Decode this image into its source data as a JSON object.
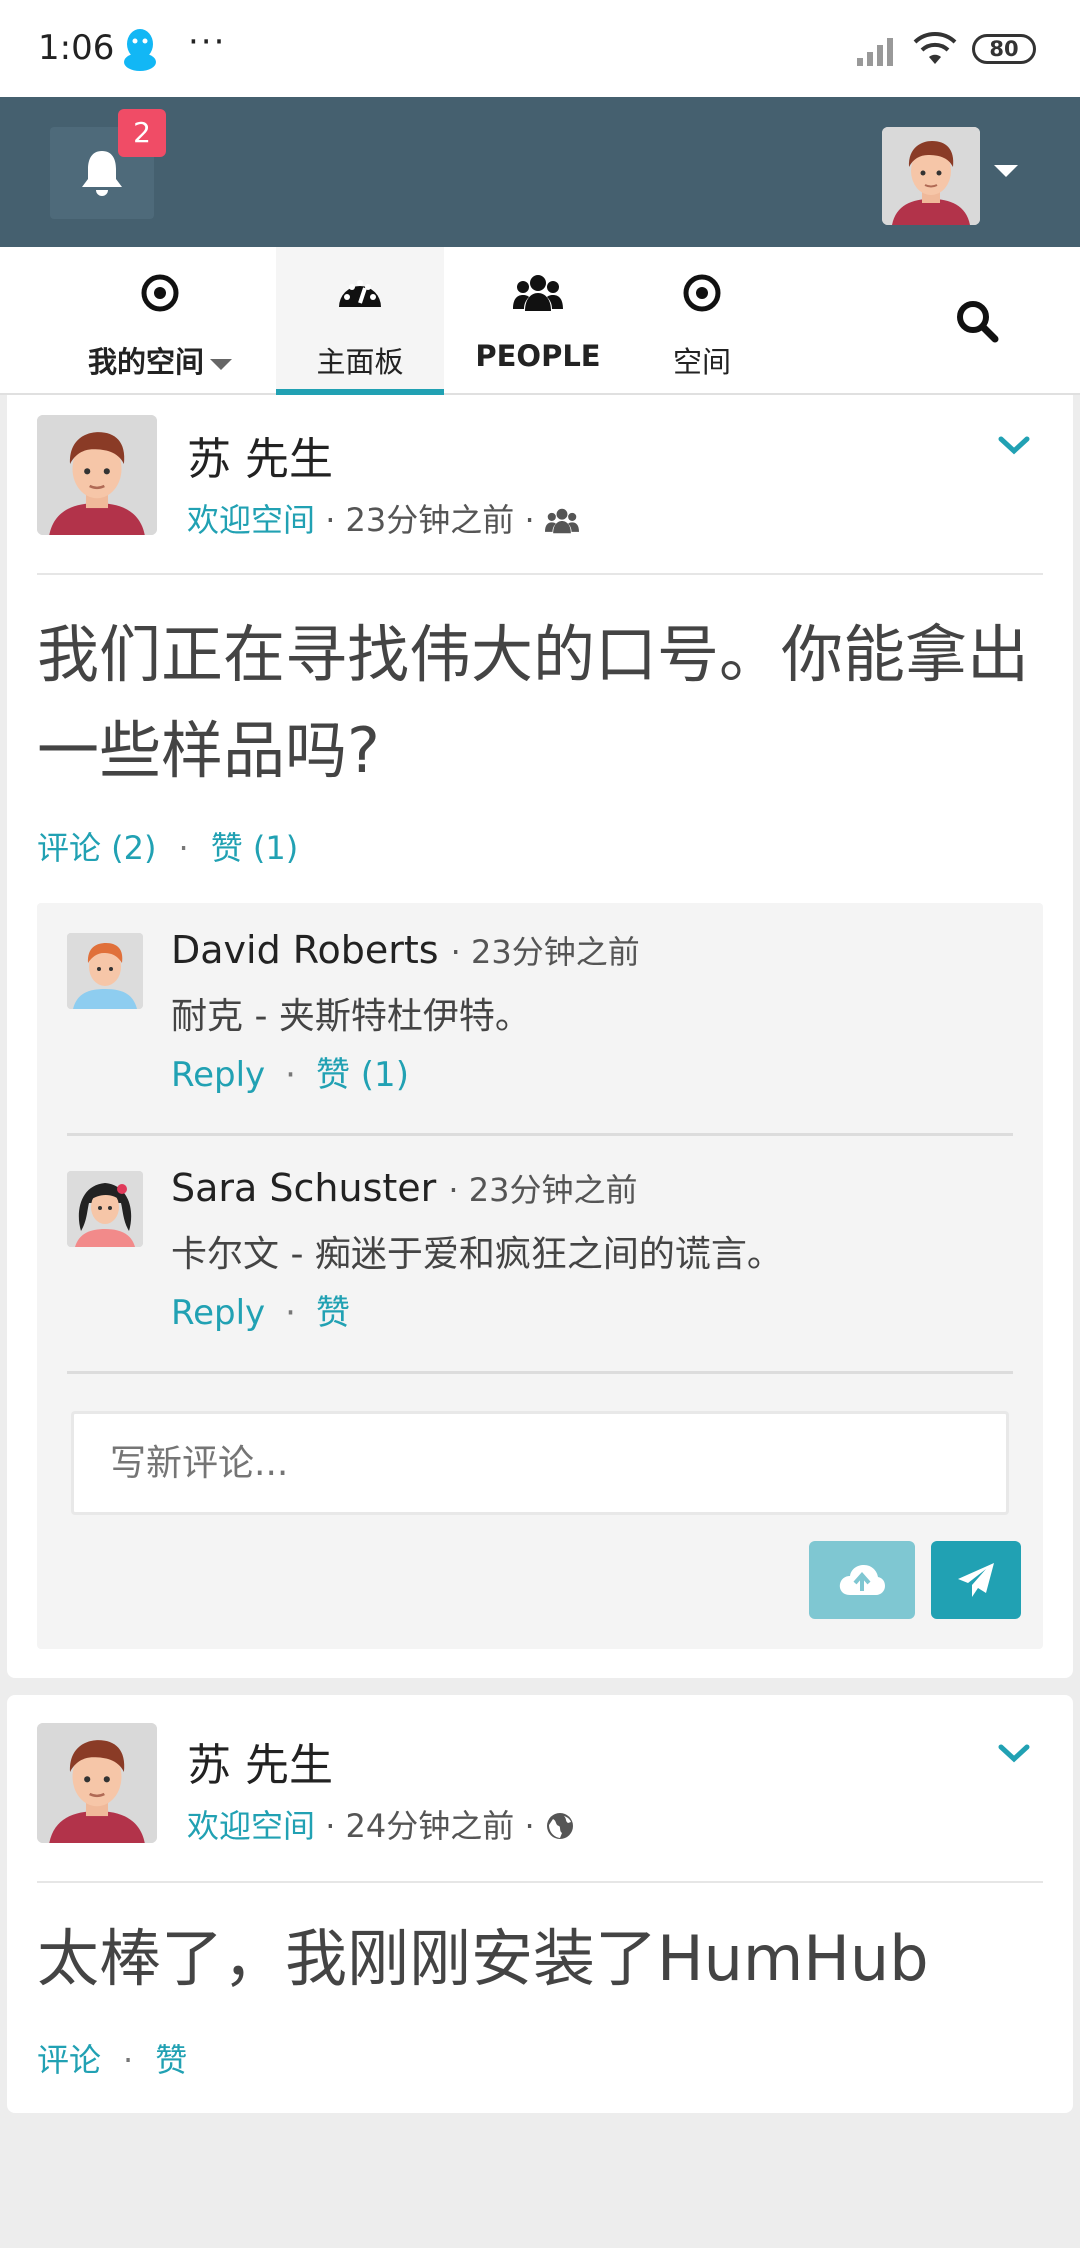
{
  "status_bar": {
    "time": "1:06",
    "dots": "···",
    "battery": "80"
  },
  "header": {
    "notifications_count": "2"
  },
  "nav": {
    "items": [
      {
        "label": "我的空间",
        "icon": "target-icon"
      },
      {
        "label": "主面板",
        "icon": "dashboard-icon"
      },
      {
        "label": "PEOPLE",
        "icon": "users-icon"
      },
      {
        "label": "空间",
        "icon": "target-icon"
      }
    ],
    "active": "主面板"
  },
  "posts": [
    {
      "author": "苏 先生",
      "space": "欢迎空间",
      "time": "23分钟之前",
      "visibility_icon": "users-icon",
      "text": "我们正在寻找伟大的口号。你能拿出一些样品吗?",
      "comment_link": "评论 (2)",
      "like_link": "赞 (1)",
      "comments": [
        {
          "author": "David Roberts",
          "time": "· 23分钟之前",
          "text": "耐克 - 夹斯特杜伊特。",
          "reply": "Reply",
          "like": "赞 (1)"
        },
        {
          "author": "Sara Schuster",
          "time": "· 23分钟之前",
          "text": "卡尔文 - 痴迷于爱和疯狂之间的谎言。",
          "reply": "Reply",
          "like": "赞"
        }
      ],
      "comment_placeholder": "写新评论..."
    },
    {
      "author": "苏 先生",
      "space": "欢迎空间",
      "time": "24分钟之前",
      "visibility_icon": "globe-icon",
      "text": "太棒了，我刚刚安装了HumHub",
      "comment_link": "评论",
      "like_link": "赞"
    }
  ],
  "colors": {
    "accent": "#21a1b3",
    "header": "#45606f",
    "badge": "#f04c66"
  }
}
